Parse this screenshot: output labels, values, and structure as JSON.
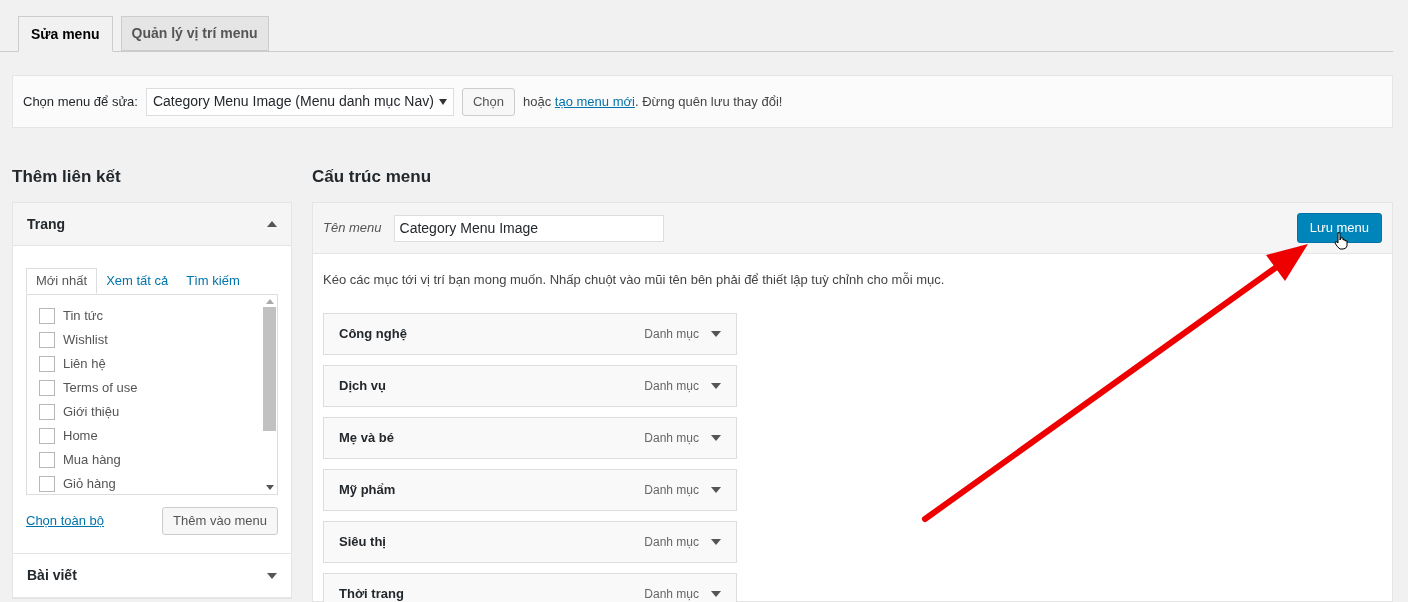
{
  "tabs": [
    {
      "label": "Sửa menu",
      "selected": true
    },
    {
      "label": "Quản lý vị trí menu",
      "selected": false
    }
  ],
  "select_bar": {
    "label": "Chọn menu để sửa:",
    "value": "Category Menu Image (Menu danh mục Nav)",
    "button": "Chọn",
    "text_before": "hoặc",
    "link": "tạo menu mới",
    "text_after": ". Đừng quên lưu thay đổi!"
  },
  "left": {
    "heading": "Thêm liên kết",
    "sections": [
      {
        "title": "Trang",
        "expanded": true,
        "tabs": [
          {
            "label": "Mới nhất",
            "selected": true
          },
          {
            "label": "Xem tất cả",
            "selected": false
          },
          {
            "label": "Tìm kiếm",
            "selected": false
          }
        ],
        "items": [
          {
            "label": "Tin tức",
            "checked": false
          },
          {
            "label": "Wishlist",
            "checked": false
          },
          {
            "label": "Liên hệ",
            "checked": false
          },
          {
            "label": "Terms of use",
            "checked": false
          },
          {
            "label": "Giới thiệu",
            "checked": false
          },
          {
            "label": "Home",
            "checked": false
          },
          {
            "label": "Mua hàng",
            "checked": false
          },
          {
            "label": "Giỏ hàng",
            "checked": false
          }
        ],
        "select_all": "Chọn toàn bộ",
        "add_button": "Thêm vào menu"
      },
      {
        "title": "Bài viết",
        "expanded": false
      }
    ]
  },
  "right": {
    "heading": "Cấu trúc menu",
    "name_label": "Tên menu",
    "name_value": "Category Menu Image",
    "save_button": "Lưu menu",
    "hint": "Kéo các mục tới vị trí bạn mong muốn. Nhấp chuột vào mũi tên bên phải để thiết lập tuỳ chỉnh cho mỗi mục.",
    "items": [
      {
        "title": "Công nghệ",
        "type": "Danh mục"
      },
      {
        "title": "Dịch vụ",
        "type": "Danh mục"
      },
      {
        "title": "Mẹ và bé",
        "type": "Danh mục"
      },
      {
        "title": "Mỹ phẩm",
        "type": "Danh mục"
      },
      {
        "title": "Siêu thị",
        "type": "Danh mục"
      },
      {
        "title": "Thời trang",
        "type": "Danh mục"
      }
    ]
  }
}
